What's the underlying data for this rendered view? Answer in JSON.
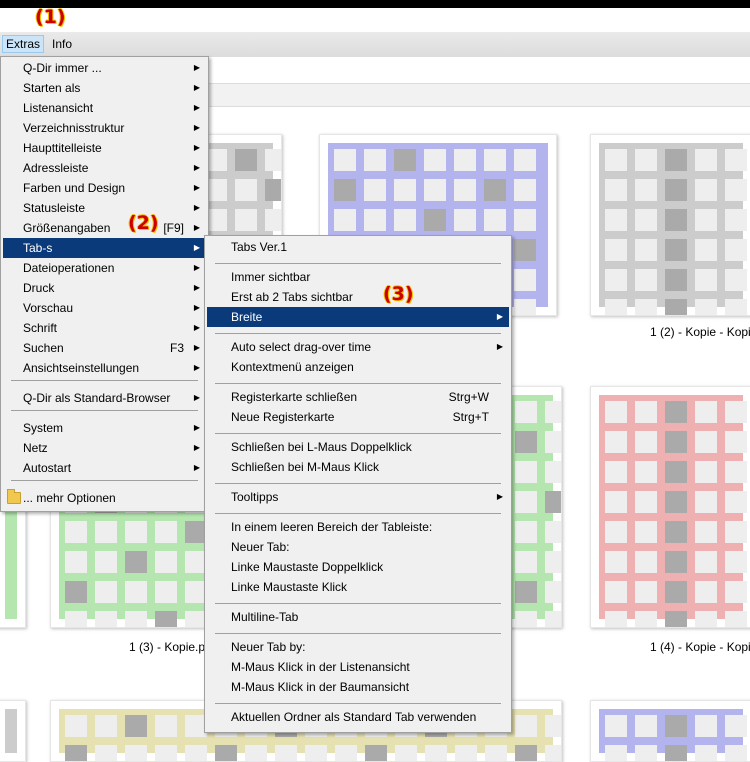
{
  "markers": {
    "m1": "(1)",
    "m2": "(2)",
    "m3": "(3)"
  },
  "menubar": {
    "extras": "Extras",
    "info": "Info"
  },
  "captions": {
    "c2": "1 (2) - Kopie - Kopi",
    "c3": "1 (3) - Kopie.p",
    "c4": "1 (4) - Kopie - Kopi"
  },
  "colors": {
    "blue": "#b3b3ee",
    "gray": "#cccccc",
    "green": "#b5e6b0",
    "red": "#eeb0b0",
    "yellow": "#e6e1b0",
    "menu_selected": "#0a3a7a",
    "marker": "#cc0000"
  },
  "extras_menu": {
    "items": [
      {
        "label": "Q-Dir immer ...",
        "sub": true
      },
      {
        "label": "Starten als",
        "sub": true
      },
      {
        "label": "Listenansicht",
        "sub": true
      },
      {
        "label": "Verzeichnisstruktur",
        "sub": true
      },
      {
        "label": "Haupttitelleiste",
        "sub": true
      },
      {
        "label": "Adressleiste",
        "sub": true
      },
      {
        "label": "Farben und Design",
        "sub": true
      },
      {
        "label": "Statusleiste",
        "sub": true
      },
      {
        "label": "Größenangaben",
        "shortcut": "[F9]",
        "sub": true
      },
      {
        "label": "Tab-s",
        "sub": true
      },
      {
        "label": "Dateioperationen",
        "sub": true
      },
      {
        "label": "Druck",
        "sub": true
      },
      {
        "label": "Vorschau",
        "sub": true
      },
      {
        "label": "Schrift",
        "sub": true
      },
      {
        "label": "Suchen",
        "shortcut": "F3",
        "sub": true
      },
      {
        "label": "Ansichtseinstellungen",
        "sub": true
      },
      {
        "label": "Q-Dir als Standard-Browser",
        "sub": true
      },
      {
        "label": "System",
        "sub": true
      },
      {
        "label": "Netz",
        "sub": true
      },
      {
        "label": "Autostart",
        "sub": true
      },
      {
        "label": "... mehr Optionen",
        "sub": false,
        "icon": "folder-icon"
      }
    ]
  },
  "tabs_menu": {
    "items": [
      {
        "label": "Tabs Ver.1"
      },
      {
        "label": "Immer sichtbar"
      },
      {
        "label": "Erst ab 2 Tabs sichtbar"
      },
      {
        "label": "Breite",
        "sub": true
      },
      {
        "label": "Auto select drag-over time",
        "sub": true
      },
      {
        "label": "Kontextmenü anzeigen"
      },
      {
        "label": "Registerkarte schließen",
        "shortcut": "Strg+W"
      },
      {
        "label": "Neue Registerkarte",
        "shortcut": "Strg+T"
      },
      {
        "label": "Schließen bei L-Maus Doppelklick"
      },
      {
        "label": "Schließen bei M-Maus Klick"
      },
      {
        "label": "Tooltipps",
        "sub": true
      },
      {
        "label": "In einem leeren Bereich der Tableiste:"
      },
      {
        "label": "Neuer Tab:"
      },
      {
        "label": "Linke Maustaste Doppelklick"
      },
      {
        "label": "Linke Maustaste Klick"
      },
      {
        "label": "Multiline-Tab"
      },
      {
        "label": "Neuer Tab by:"
      },
      {
        "label": "M-Maus Klick in der Listenansicht"
      },
      {
        "label": "M-Maus Klick in der Baumansicht"
      },
      {
        "label": "Aktuellen Ordner als Standard Tab verwenden"
      }
    ]
  }
}
